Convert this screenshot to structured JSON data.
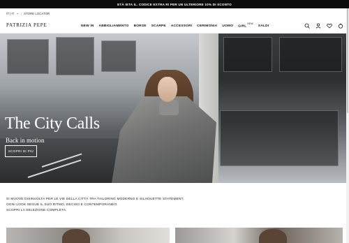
{
  "promo": {
    "text": "ETÀ IETA IL. CODICE EXTRA RI PER UN ULTERIORE 10% DI SCONTO"
  },
  "utility": {
    "language": "IT | IT",
    "chevron": "⌄",
    "separator": "|",
    "store_locator": "STORE LOCATOR"
  },
  "header": {
    "logo": "PATRIZIA PEPE",
    "nav": [
      {
        "label": "NEW IN"
      },
      {
        "label": "ABBIGLIAMENTO"
      },
      {
        "label": "BORSE"
      },
      {
        "label": "SCARPE"
      },
      {
        "label": "ACCESSORI"
      },
      {
        "label": "CERIMONIA"
      },
      {
        "label": "UOMO"
      },
      {
        "label": "GIRL",
        "badge": "NEW"
      },
      {
        "label": "SALDI"
      }
    ],
    "icons": [
      "search-icon",
      "user-icon",
      "heart-icon",
      "bag-icon"
    ]
  },
  "hero": {
    "title": "The City Calls",
    "subtitle": "Back in motion",
    "button_label": "SCOPRI DI PIÙ"
  },
  "description": {
    "lines": [
      "SI MUOVE DISINVOLTA PER LE VIE DELLA CITTÀ TRA TAILORING MODERNO E SILHOUETTE STATEMENT.",
      "OGNI LOOK SEGUE IL SUO RITMO, DECISO E CONTEMPORANEO.",
      "SCOPRI LA SELEZIONE COMPLETA."
    ]
  },
  "colors": {
    "promo_bg": "#0b0b0b",
    "text": "#111111",
    "background": "#ffffff"
  }
}
